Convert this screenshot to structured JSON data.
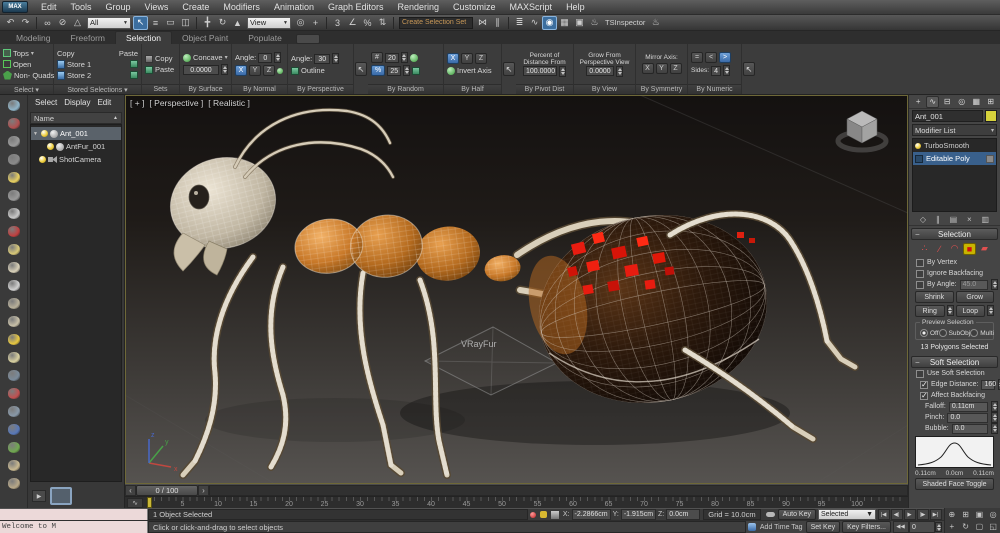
{
  "app": {
    "logo": "MAX",
    "accent": "#4d82c4"
  },
  "menubar": {
    "items": [
      "Edit",
      "Tools",
      "Group",
      "Views",
      "Create",
      "Modifiers",
      "Animation",
      "Graph Editors",
      "Rendering",
      "Customize",
      "MAXScript",
      "Help"
    ]
  },
  "toolbar": {
    "sequence": [
      {
        "type": "icon",
        "name": "undo-icon",
        "glyph": "↶"
      },
      {
        "type": "icon",
        "name": "redo-icon",
        "glyph": "↷"
      },
      {
        "type": "sep"
      },
      {
        "type": "icon",
        "name": "select-and-link-icon",
        "glyph": "∞"
      },
      {
        "type": "icon",
        "name": "unlink-selection-icon",
        "glyph": "⊘"
      },
      {
        "type": "icon",
        "name": "bind-to-space-warp-icon",
        "glyph": "△"
      },
      {
        "type": "select",
        "name": "selection-filter-dropdown",
        "value": "All"
      },
      {
        "type": "icon",
        "name": "select-object-icon",
        "glyph": "↖",
        "active": true
      },
      {
        "type": "icon",
        "name": "select-by-name-icon",
        "glyph": "≡"
      },
      {
        "type": "icon",
        "name": "rectangular-region-icon",
        "glyph": "▭"
      },
      {
        "type": "icon",
        "name": "window-crossing-icon",
        "glyph": "◫"
      },
      {
        "type": "sep"
      },
      {
        "type": "icon",
        "name": "move-icon",
        "glyph": "╋"
      },
      {
        "type": "icon",
        "name": "rotate-icon",
        "glyph": "↻"
      },
      {
        "type": "icon",
        "name": "scale-icon",
        "glyph": "▲"
      },
      {
        "type": "select",
        "name": "reference-coordinate-dropdown",
        "value": "View"
      },
      {
        "type": "icon",
        "name": "use-pivot-center-icon",
        "glyph": "◎"
      },
      {
        "type": "icon",
        "name": "select-manipulate-icon",
        "glyph": "+"
      },
      {
        "type": "sep"
      },
      {
        "type": "icon",
        "name": "snap-toggle-icon",
        "glyph": "3"
      },
      {
        "type": "icon",
        "name": "angle-snap-icon",
        "glyph": "∠"
      },
      {
        "type": "icon",
        "name": "percent-snap-icon",
        "glyph": "%"
      },
      {
        "type": "icon",
        "name": "spinner-snap-icon",
        "glyph": "⇅"
      },
      {
        "type": "sep"
      },
      {
        "type": "input",
        "name": "named-selection-set-field",
        "value": "Create Selection Set"
      },
      {
        "type": "icon",
        "name": "mirror-icon",
        "glyph": "⋈"
      },
      {
        "type": "icon",
        "name": "align-icon",
        "glyph": "∥"
      },
      {
        "type": "sep"
      },
      {
        "type": "icon",
        "name": "layer-manager-icon",
        "glyph": "≣"
      },
      {
        "type": "icon",
        "name": "curve-editor-icon",
        "glyph": "∿"
      },
      {
        "type": "icon",
        "name": "material-editor-icon",
        "glyph": "◉",
        "active": true
      },
      {
        "type": "icon",
        "name": "render-setup-icon",
        "glyph": "▦"
      },
      {
        "type": "icon",
        "name": "rendered-frame-icon",
        "glyph": "▣"
      },
      {
        "type": "icon",
        "name": "render-production-icon",
        "glyph": "♨"
      },
      {
        "type": "label",
        "name": "tsinspector-label",
        "text": "TSInspector"
      },
      {
        "type": "icon",
        "name": "tsinspector-teapot-icon",
        "glyph": "♨"
      }
    ]
  },
  "ribbon": {
    "tabs": [
      {
        "label": "Modeling",
        "active": false
      },
      {
        "label": "Freeform",
        "active": false
      },
      {
        "label": "Selection",
        "active": true
      },
      {
        "label": "Object Paint",
        "active": false
      },
      {
        "label": "Populate",
        "active": false
      }
    ],
    "select": {
      "label": "Select ▾",
      "tops": "Tops",
      "open": "Open",
      "non_quads": "Non- Quads"
    },
    "stored": {
      "label": "Stored Selections ▾",
      "copy": "Copy",
      "paste": "Paste",
      "store1": "Store 1",
      "store2": "Store 2"
    },
    "sets": {
      "label": "Sets",
      "copy": "Copy",
      "paste": "Paste"
    },
    "by_surface": {
      "label": "By Surface",
      "mode": "Concave",
      "value": "0.0000"
    },
    "by_normal": {
      "label": "By Normal",
      "angle_label": "Angle:",
      "angle": "0",
      "x": "X",
      "y": "Y",
      "z": "Z"
    },
    "by_perspective": {
      "label": "By Perspective",
      "angle_label": "Angle:",
      "angle": "30",
      "outline": "Outline"
    },
    "by_random": {
      "label": "By Random",
      "hash": "#",
      "count": "20",
      "percent_sign": "%",
      "percent": "25"
    },
    "by_half": {
      "label": "By Half",
      "x": "X",
      "y": "Y",
      "z": "Z",
      "invert": "Invert Axis"
    },
    "by_pivot": {
      "label": "By Pivot Dist",
      "line1": "Percent of",
      "line2": "Distance From",
      "value": "100.0000"
    },
    "by_view": {
      "label": "By View",
      "line1": "Grow From",
      "line2": "Perspective View",
      "value": "0.0000"
    },
    "by_symmetry": {
      "label": "By Symmetry",
      "axis_label": "Mirror Axis:",
      "x": "X",
      "y": "Y",
      "z": "Z"
    },
    "by_numeric": {
      "label": "By Numeric",
      "eq": "=",
      "lt": "<",
      "gt": ">",
      "sides_label": "Sides:",
      "sides": "4"
    }
  },
  "left_toolbar": {
    "icons": [
      {
        "name": "sphere-view-icon",
        "color": "#8fb4c8"
      },
      {
        "name": "display-panel-icon",
        "color": "#b05050"
      },
      {
        "name": "list-view-icon",
        "color": "#9a9a9a"
      },
      {
        "name": "spreadsheet-icon",
        "color": "#8a8a8a"
      },
      {
        "name": "light-bulb-icon",
        "color": "#e8d060"
      },
      {
        "name": "plug-icon",
        "color": "#9a9a9a"
      },
      {
        "name": "moon-icon",
        "color": "#c8c8c8"
      },
      {
        "name": "glasses-icon",
        "color": "#c04040"
      },
      {
        "name": "plane-primitive-icon",
        "color": "#d8c878"
      },
      {
        "name": "dome-primitive-icon",
        "color": "#d8d0b8"
      },
      {
        "name": "sphere-primitive-icon",
        "color": "#d0d0d0"
      },
      {
        "name": "torus-primitive-icon",
        "color": "#b8b09a"
      },
      {
        "name": "cone-primitive-icon",
        "color": "#c8c0a8"
      },
      {
        "name": "sun-icon",
        "color": "#e8c840"
      },
      {
        "name": "ball-icon",
        "color": "#d8d0a0"
      },
      {
        "name": "waves-icon",
        "color": "#7a8a9a"
      },
      {
        "name": "spheres-icon",
        "color": "#c05050"
      },
      {
        "name": "gamepad-icon",
        "color": "#8898a8"
      },
      {
        "name": "globe-icon",
        "color": "#5878b8"
      },
      {
        "name": "leaf-icon",
        "color": "#70a850"
      },
      {
        "name": "hand-icon",
        "color": "#c8b890"
      },
      {
        "name": "shell-icon",
        "color": "#b8a888"
      }
    ]
  },
  "explorer": {
    "menu": [
      "Select",
      "Display",
      "Edit"
    ],
    "column_header": "Name",
    "nodes": [
      {
        "label": "Ant_001"
      },
      {
        "label": "AntFur_001"
      },
      {
        "label": "ShotCamera"
      }
    ]
  },
  "viewport": {
    "label_plus": "[ + ]",
    "label_view": "[ Perspective ]",
    "label_shading": "[ Realistic ]",
    "gizmo_label": "VRayFur",
    "axis_x": "x",
    "axis_y": "y",
    "axis_z": "z"
  },
  "command_panel": {
    "tabs": [
      {
        "name": "create-tab-icon",
        "glyph": "+",
        "active": false
      },
      {
        "name": "modify-tab-icon",
        "glyph": "∿",
        "active": true
      },
      {
        "name": "hierarchy-tab-icon",
        "glyph": "⊟",
        "active": false
      },
      {
        "name": "motion-tab-icon",
        "glyph": "◎",
        "active": false
      },
      {
        "name": "display-tab-icon",
        "glyph": "▦",
        "active": false
      },
      {
        "name": "utilities-tab-icon",
        "glyph": "⊞",
        "active": false
      }
    ],
    "object_name": "Ant_001",
    "modifier_list_label": "Modifier List",
    "stack": [
      {
        "label": "TurboSmooth",
        "selected": false
      },
      {
        "label": "Editable Poly",
        "selected": true
      }
    ],
    "stack_tools": [
      {
        "name": "pin-stack-icon",
        "glyph": "◇"
      },
      {
        "name": "show-end-result-icon",
        "glyph": "∥"
      },
      {
        "name": "make-unique-icon",
        "glyph": "▤"
      },
      {
        "name": "remove-modifier-icon",
        "glyph": "×"
      },
      {
        "name": "configure-modifier-icon",
        "glyph": "▥"
      }
    ],
    "selection": {
      "title": "Selection",
      "subobject_icons": [
        {
          "name": "vertex-subobject-icon",
          "glyph": "∴",
          "active": false
        },
        {
          "name": "edge-subobject-icon",
          "glyph": "∕",
          "active": false
        },
        {
          "name": "border-subobject-icon",
          "glyph": "◠",
          "active": false
        },
        {
          "name": "polygon-subobject-icon",
          "glyph": "■",
          "active": true
        },
        {
          "name": "element-subobject-icon",
          "glyph": "▰",
          "active": false
        }
      ],
      "by_vertex": "By Vertex",
      "ignore_backfacing": "Ignore Backfacing",
      "by_angle": "By Angle:",
      "by_angle_value": "45.0",
      "shrink": "Shrink",
      "grow": "Grow",
      "ring": "Ring",
      "loop": "Loop",
      "preview_label": "Preview Selection",
      "preview_off": "Off",
      "preview_subobj": "SubObj",
      "preview_multi": "Multi",
      "status": "13 Polygons Selected"
    },
    "soft_selection": {
      "title": "Soft Selection",
      "use_soft": "Use Soft Selection",
      "edge_distance": "Edge Distance:",
      "edge_distance_value": "160",
      "affect_backfacing": "Affect Backfacing",
      "falloff_label": "Falloff:",
      "falloff": "0.11cm",
      "pinch_label": "Pinch:",
      "pinch": "0.0",
      "bubble_label": "Bubble:",
      "bubble": "0.0",
      "curve_left": "0.11cm",
      "curve_mid": "0.0cm",
      "curve_right": "0.11cm",
      "shaded_face": "Shaded Face Toggle"
    }
  },
  "timeline": {
    "slider_value": "0 / 100",
    "ticks": [
      5,
      10,
      15,
      20,
      25,
      30,
      35,
      40,
      45,
      50,
      55,
      60,
      65,
      70,
      75,
      80,
      85,
      90,
      95,
      100
    ]
  },
  "statusbar": {
    "listener_text": "Welcome to M",
    "selected_text": "1 Object Selected",
    "prompt": "Click or click-and-drag to select objects",
    "x_label": "X:",
    "x": "-2.2866cm",
    "y_label": "Y:",
    "y": "-1.915cm",
    "z_label": "Z:",
    "z": "0.0cm",
    "grid": "Grid = 10.0cm",
    "add_time_tag": "Add Time Tag",
    "auto_key": "Auto Key",
    "set_key": "Set Key",
    "key_mode": "Selected",
    "key_filters": "Key Filters...",
    "frame": "0",
    "playback": [
      {
        "name": "go-to-start-icon",
        "glyph": "|◀"
      },
      {
        "name": "previous-frame-icon",
        "glyph": "◀|"
      },
      {
        "name": "play-icon",
        "glyph": "▶"
      },
      {
        "name": "next-frame-icon",
        "glyph": "|▶"
      },
      {
        "name": "go-to-end-icon",
        "glyph": "▶|"
      }
    ],
    "nav_icons": [
      {
        "name": "zoom-icon",
        "glyph": "⊕"
      },
      {
        "name": "zoom-all-icon",
        "glyph": "⊞"
      },
      {
        "name": "zoom-extents-icon",
        "glyph": "▣"
      },
      {
        "name": "fov-icon",
        "glyph": "◎"
      },
      {
        "name": "pan-icon",
        "glyph": "+"
      },
      {
        "name": "orbit-icon",
        "glyph": "↻"
      },
      {
        "name": "region-zoom-icon",
        "glyph": "▢"
      },
      {
        "name": "maximize-viewport-icon",
        "glyph": "◱"
      }
    ]
  }
}
